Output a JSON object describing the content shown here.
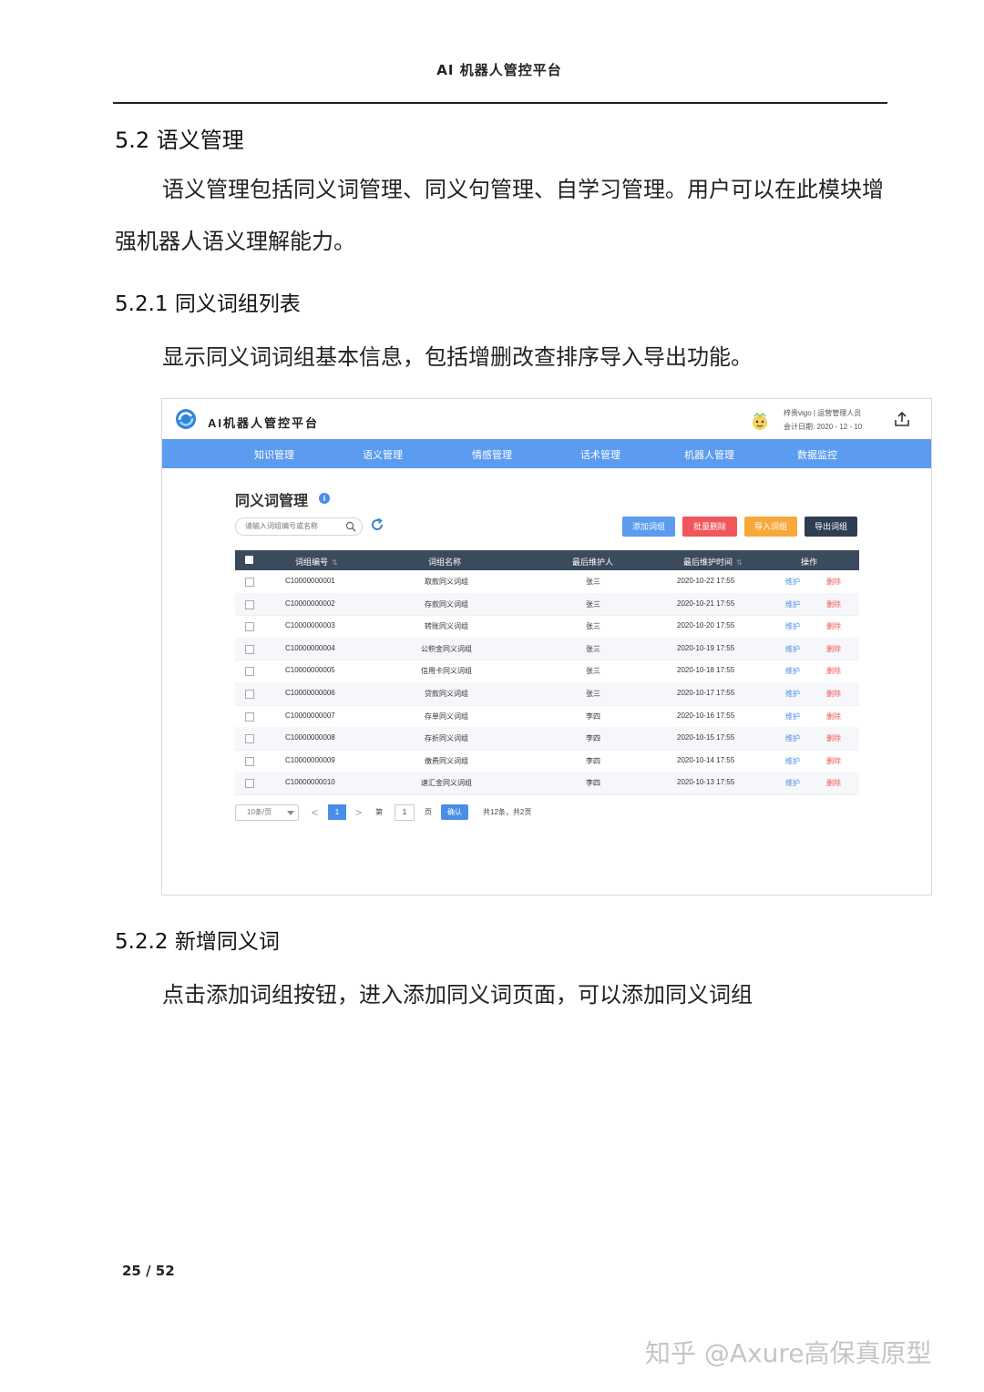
{
  "doc": {
    "header": "AI 机器人管控平台",
    "section_52": "5.2  语义管理",
    "intro": "语义管理包括同义词管理、同义句管理、自学习管理。用户可以在此模块增强机器人语义理解能力。",
    "section_521": "5.2.1  同义词组列表",
    "desc_521": "显示同义词词组基本信息，包括增删改查排序导入导出功能。",
    "section_522": "5.2.2  新增同义词",
    "desc_522": "点击添加词组按钮，进入添加同义词页面，可以添加同义词组",
    "page_number": "25 / 52",
    "watermark": "知乎 @Axure高保真原型"
  },
  "app": {
    "title": "AI机器人管控平台",
    "user": "梓贵vigo | 运营管理人员",
    "date": "会计日期: 2020 - 12 - 10",
    "nav": [
      "知识管理",
      "语义管理",
      "情感管理",
      "话术管理",
      "机器人管理",
      "数据监控"
    ],
    "page_title": "同义词管理",
    "search_placeholder": "请输入词组编号或名称",
    "buttons": {
      "add": "添加词组",
      "batch_delete": "批量删除",
      "import": "导入词组",
      "export": "导出词组"
    },
    "columns": [
      "词组编号",
      "词组名称",
      "最后维护人",
      "最后维护时间",
      "操作"
    ],
    "rows": [
      {
        "code": "C10000000001",
        "name": "取款同义词组",
        "maintainer": "张三",
        "time": "2020-10-22 17:55",
        "edit": "维护",
        "delete": "删除"
      },
      {
        "code": "C10000000002",
        "name": "存款同义词组",
        "maintainer": "张三",
        "time": "2020-10-21 17:55",
        "edit": "维护",
        "delete": "删除"
      },
      {
        "code": "C10000000003",
        "name": "转账同义词组",
        "maintainer": "张三",
        "time": "2020-10-20 17:55",
        "edit": "维护",
        "delete": "删除"
      },
      {
        "code": "C10000000004",
        "name": "公积金同义词组",
        "maintainer": "张三",
        "time": "2020-10-19 17:55",
        "edit": "维护",
        "delete": "删除"
      },
      {
        "code": "C10000000005",
        "name": "信用卡同义词组",
        "maintainer": "张三",
        "time": "2020-10-18 17:55",
        "edit": "维护",
        "delete": "删除"
      },
      {
        "code": "C10000000006",
        "name": "贷款同义词组",
        "maintainer": "张三",
        "time": "2020-10-17 17:55",
        "edit": "维护",
        "delete": "删除"
      },
      {
        "code": "C10000000007",
        "name": "存单同义词组",
        "maintainer": "李四",
        "time": "2020-10-16 17:55",
        "edit": "维护",
        "delete": "删除"
      },
      {
        "code": "C10000000008",
        "name": "存折同义词组",
        "maintainer": "李四",
        "time": "2020-10-15 17:55",
        "edit": "维护",
        "delete": "删除"
      },
      {
        "code": "C10000000009",
        "name": "缴费同义词组",
        "maintainer": "李四",
        "time": "2020-10-14 17:55",
        "edit": "维护",
        "delete": "删除"
      },
      {
        "code": "C10000000010",
        "name": "速汇金同义词组",
        "maintainer": "李四",
        "time": "2020-10-13 17:55",
        "edit": "维护",
        "delete": "删除"
      }
    ],
    "pager": {
      "size": "10条/页",
      "current": "1",
      "di": "第",
      "input": "1",
      "ye": "页",
      "confirm": "确认",
      "total": "共12条，共2页"
    }
  },
  "colors": {
    "nav": "#5b9bf0",
    "table_head": "#3c4a5e",
    "danger": "#f0565a",
    "warning": "#f7a93b",
    "primary": "#4a8de6"
  },
  "icons": [
    "app-logo-icon",
    "user-avatar-icon",
    "upload-icon",
    "info-icon",
    "search-icon",
    "refresh-icon",
    "sort-icon",
    "dropdown-caret-icon"
  ]
}
